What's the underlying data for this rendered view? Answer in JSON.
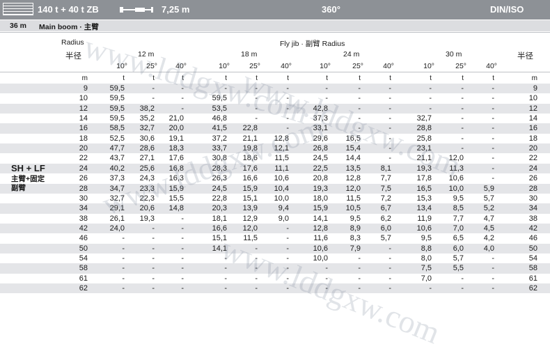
{
  "header": {
    "capacity": "140 t + 40 t ZB",
    "jib_length": "7,25 m",
    "slew": "360°",
    "standard": "DIN/ISO"
  },
  "subheader": {
    "boom_length": "36 m",
    "boom_label": "Main boom · 主臂"
  },
  "table_header": {
    "radius_left_en": "Radius",
    "radius_left_cn": "半径",
    "flyjib": "Fly jib · 副臂 Radius",
    "radius_right_cn": "半径",
    "groups": [
      "12 m",
      "18 m",
      "24 m",
      "30 m"
    ],
    "angles": [
      "10°",
      "25°",
      "40°",
      "10°",
      "25°",
      "40°",
      "10°",
      "25°",
      "40°",
      "10°",
      "25°",
      "40°"
    ],
    "units": [
      "m",
      "t",
      "t",
      "t",
      "t",
      "t",
      "t",
      "t",
      "t",
      "t",
      "t",
      "t",
      "t",
      "m"
    ]
  },
  "side_label": {
    "code": "SH + LF",
    "cn_line1": "主臂+固定",
    "cn_line2": "副臂"
  },
  "rows": [
    [
      "9",
      "59,5",
      "-",
      "-",
      "-",
      "-",
      "-",
      "-",
      "-",
      "-",
      "-",
      "-",
      "-",
      "9"
    ],
    [
      "10",
      "59,5",
      "-",
      "-",
      "59,5",
      "-",
      "-",
      "-",
      "-",
      "-",
      "-",
      "-",
      "-",
      "10"
    ],
    [
      "12",
      "59,5",
      "38,2",
      "-",
      "53,5",
      "-",
      "-",
      "42,8",
      "-",
      "-",
      "-",
      "-",
      "-",
      "12"
    ],
    [
      "14",
      "59,5",
      "35,2",
      "21,0",
      "46,8",
      "-",
      "-",
      "37,3",
      "-",
      "-",
      "32,7",
      "-",
      "-",
      "14"
    ],
    [
      "16",
      "58,5",
      "32,7",
      "20,0",
      "41,5",
      "22,8",
      "-",
      "33,1",
      "-",
      "-",
      "28,8",
      "-",
      "-",
      "16"
    ],
    [
      "18",
      "52,5",
      "30,6",
      "19,1",
      "37,2",
      "21,1",
      "12,8",
      "29,6",
      "16,5",
      "-",
      "25,8",
      "-",
      "-",
      "18"
    ],
    [
      "20",
      "47,7",
      "28,6",
      "18,3",
      "33,7",
      "19,8",
      "12,1",
      "26,8",
      "15,4",
      "-",
      "23,1",
      "-",
      "-",
      "20"
    ],
    [
      "22",
      "43,7",
      "27,1",
      "17,6",
      "30,8",
      "18,6",
      "11,5",
      "24,5",
      "14,4",
      "-",
      "21,1",
      "12,0",
      "-",
      "22"
    ],
    [
      "24",
      "40,2",
      "25,6",
      "16,8",
      "28,3",
      "17,6",
      "11,1",
      "22,5",
      "13,5",
      "8,1",
      "19,3",
      "11,3",
      "-",
      "24"
    ],
    [
      "26",
      "37,3",
      "24,3",
      "16,3",
      "26,3",
      "16,6",
      "10,6",
      "20,8",
      "12,8",
      "7,7",
      "17,8",
      "10,6",
      "-",
      "26"
    ],
    [
      "28",
      "34,7",
      "23,3",
      "15,9",
      "24,5",
      "15,9",
      "10,4",
      "19,3",
      "12,0",
      "7,5",
      "16,5",
      "10,0",
      "5,9",
      "28"
    ],
    [
      "30",
      "32,7",
      "22,3",
      "15,5",
      "22,8",
      "15,1",
      "10,0",
      "18,0",
      "11,5",
      "7,2",
      "15,3",
      "9,5",
      "5,7",
      "30"
    ],
    [
      "34",
      "29,1",
      "20,6",
      "14,8",
      "20,3",
      "13,9",
      "9,4",
      "15,9",
      "10,5",
      "6,7",
      "13,4",
      "8,5",
      "5,2",
      "34"
    ],
    [
      "38",
      "26,1",
      "19,3",
      "-",
      "18,1",
      "12,9",
      "9,0",
      "14,1",
      "9,5",
      "6,2",
      "11,9",
      "7,7",
      "4,7",
      "38"
    ],
    [
      "42",
      "24,0",
      "-",
      "-",
      "16,6",
      "12,0",
      "-",
      "12,8",
      "8,9",
      "6,0",
      "10,6",
      "7,0",
      "4,5",
      "42"
    ],
    [
      "46",
      "-",
      "-",
      "-",
      "15,1",
      "11,5",
      "-",
      "11,6",
      "8,3",
      "5,7",
      "9,5",
      "6,5",
      "4,2",
      "46"
    ],
    [
      "50",
      "-",
      "-",
      "-",
      "14,1",
      "-",
      "-",
      "10,6",
      "7,9",
      "-",
      "8,8",
      "6,0",
      "4,0",
      "50"
    ],
    [
      "54",
      "-",
      "-",
      "-",
      "-",
      "-",
      "-",
      "10,0",
      "-",
      "-",
      "8,0",
      "5,7",
      "-",
      "54"
    ],
    [
      "58",
      "-",
      "-",
      "-",
      "-",
      "-",
      "-",
      "-",
      "-",
      "-",
      "7,5",
      "5,5",
      "-",
      "58"
    ],
    [
      "61",
      "-",
      "-",
      "-",
      "-",
      "-",
      "-",
      "-",
      "-",
      "-",
      "7,0",
      "-",
      "-",
      "61"
    ],
    [
      "62",
      "-",
      "-",
      "-",
      "-",
      "-",
      "-",
      "-",
      "-",
      "-",
      "-",
      "-",
      "-",
      "62"
    ]
  ],
  "watermarks": [
    "www.lddgxw.com",
    "www.lddgxw.com",
    "www.lddgxw.com",
    "www.lddgxw.com"
  ]
}
